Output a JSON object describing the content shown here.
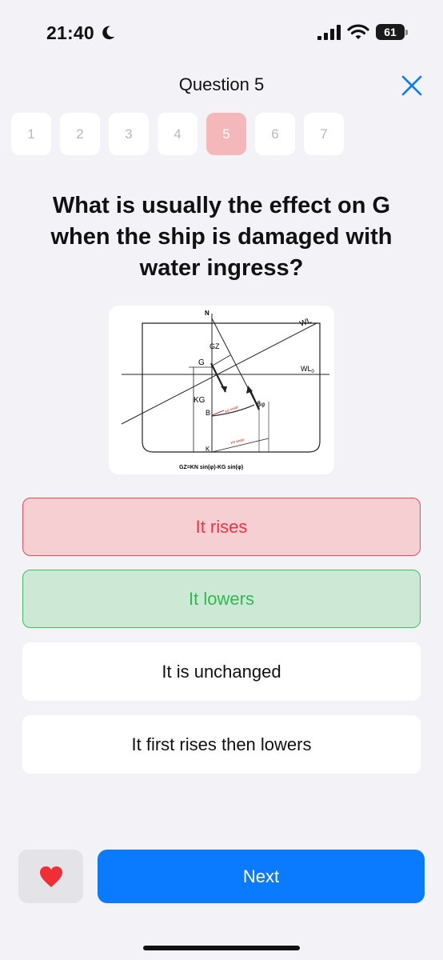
{
  "status_bar": {
    "time": "21:40",
    "battery": "61",
    "icons": [
      "moon-icon",
      "signal-icon",
      "wifi-icon",
      "battery-icon"
    ]
  },
  "header": {
    "title": "Question 5",
    "close_icon": "close-icon"
  },
  "steps": [
    {
      "label": "1",
      "active": false
    },
    {
      "label": "2",
      "active": false
    },
    {
      "label": "3",
      "active": false
    },
    {
      "label": "4",
      "active": false
    },
    {
      "label": "5",
      "active": true
    },
    {
      "label": "6",
      "active": false
    },
    {
      "label": "7",
      "active": false
    }
  ],
  "question": {
    "text": "What is usually the effect on G when the ship is damaged with water ingress?"
  },
  "diagram": {
    "labels": {
      "n": "N",
      "wl": "WL",
      "wl0": "WL",
      "wl0_sub": "0",
      "gz": "GZ",
      "g": "G",
      "kg": "KG",
      "b": "B",
      "bphi": "Bφ",
      "k": "K",
      "kg_sin": "KG sin(φ)",
      "kn_sin": "KN sin(φ)",
      "formula": "GZ=KN sin(φ)-KG sin(φ)"
    }
  },
  "answers": [
    {
      "label": "It rises",
      "state": "wrong"
    },
    {
      "label": "It lowers",
      "state": "right"
    },
    {
      "label": "It is unchanged",
      "state": "neutral"
    },
    {
      "label": "It first rises then lowers",
      "state": "neutral"
    }
  ],
  "footer": {
    "favorite_icon": "heart-icon",
    "next_label": "Next"
  },
  "colors": {
    "accent": "#0a7aff",
    "wrong": "#ee3340",
    "right": "#2fb94e",
    "active_step": "#f5b8ba"
  }
}
